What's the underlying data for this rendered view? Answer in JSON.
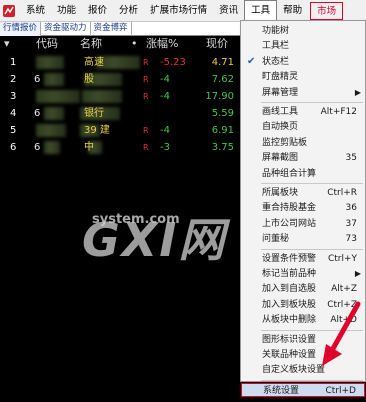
{
  "menubar": {
    "items": [
      "系统",
      "功能",
      "报价",
      "分析",
      "扩展市场行情",
      "资讯",
      "工具",
      "帮助",
      "市场"
    ]
  },
  "tabs": [
    "行情报价",
    "资金驱动力",
    "资金博弈"
  ],
  "table": {
    "headers": {
      "code": "代码",
      "name": "名称",
      "dot": "•",
      "change": "涨幅%",
      "price": "现价"
    },
    "rows": [
      {
        "idx": "1",
        "code": "",
        "name": "高速",
        "flag": "R",
        "change": "-5.23",
        "price": "4.71",
        "price_color": "#e8d04a",
        "change_color": "#e0303a"
      },
      {
        "idx": "2",
        "code": "6",
        "name": "股",
        "flag": "R",
        "change": "-4",
        "price": "7.62",
        "price_color": "#43c643",
        "change_color": "#43c643"
      },
      {
        "idx": "3",
        "code": "",
        "name": "",
        "flag": "R",
        "change": "-4",
        "price": "17.90",
        "price_color": "#43c643",
        "change_color": "#43c643"
      },
      {
        "idx": "4",
        "code": "6",
        "name": "银行",
        "flag": "",
        "change": "",
        "price": "5.59",
        "price_color": "#43c643",
        "change_color": "#43c643"
      },
      {
        "idx": "5",
        "code": "",
        "name": "39 建",
        "flag": "R",
        "change": "-4",
        "price": "6.91",
        "price_color": "#43c643",
        "change_color": "#43c643"
      },
      {
        "idx": "6",
        "code": "6",
        "name": "中",
        "flag": "R",
        "change": "-3",
        "price": "3.75",
        "price_color": "#43c643",
        "change_color": "#43c643"
      }
    ]
  },
  "watermark": {
    "big": "GXI网",
    "small": "system.com"
  },
  "tools_menu": {
    "items": [
      {
        "label": "功能树",
        "shortcut": ""
      },
      {
        "label": "工具栏",
        "shortcut": ""
      },
      {
        "label": "状态栏",
        "shortcut": "",
        "checked": true
      },
      {
        "label": "盯盘精灵",
        "shortcut": ""
      },
      {
        "label": "屏幕管理",
        "shortcut": "",
        "submenu": true
      },
      {
        "label": "画线工具",
        "shortcut": "Alt+F12"
      },
      {
        "label": "自动换页",
        "shortcut": ""
      },
      {
        "label": "监控剪贴板",
        "shortcut": ""
      },
      {
        "label": "屏幕截图",
        "shortcut": "35"
      },
      {
        "label": "品种组合计算",
        "shortcut": ""
      },
      {
        "label": "所属板块",
        "shortcut": "Ctrl+R"
      },
      {
        "label": "重合持股基金",
        "shortcut": "36"
      },
      {
        "label": "上市公司网站",
        "shortcut": "37"
      },
      {
        "label": "问董秘",
        "shortcut": "73"
      },
      {
        "label": "设置条件预警",
        "shortcut": "Ctrl+Y"
      },
      {
        "label": "标记当前品种",
        "shortcut": "",
        "submenu": true
      },
      {
        "label": "加入到自选股",
        "shortcut": "Alt+Z"
      },
      {
        "label": "加入到板块股",
        "shortcut": "Ctrl+Z"
      },
      {
        "label": "从板块中删除",
        "shortcut": "Alt+D"
      },
      {
        "label": "图形标识设置",
        "shortcut": ""
      },
      {
        "label": "关联品种设置",
        "shortcut": ""
      },
      {
        "label": "自定义板块设置",
        "shortcut": ""
      },
      {
        "label": "系统设置",
        "shortcut": "Ctrl+D",
        "highlighted": true
      }
    ]
  },
  "colors": {
    "accent_red": "#e0002a",
    "menu_bg": "#f3f3f3",
    "highlight": "#cfdcf0"
  }
}
